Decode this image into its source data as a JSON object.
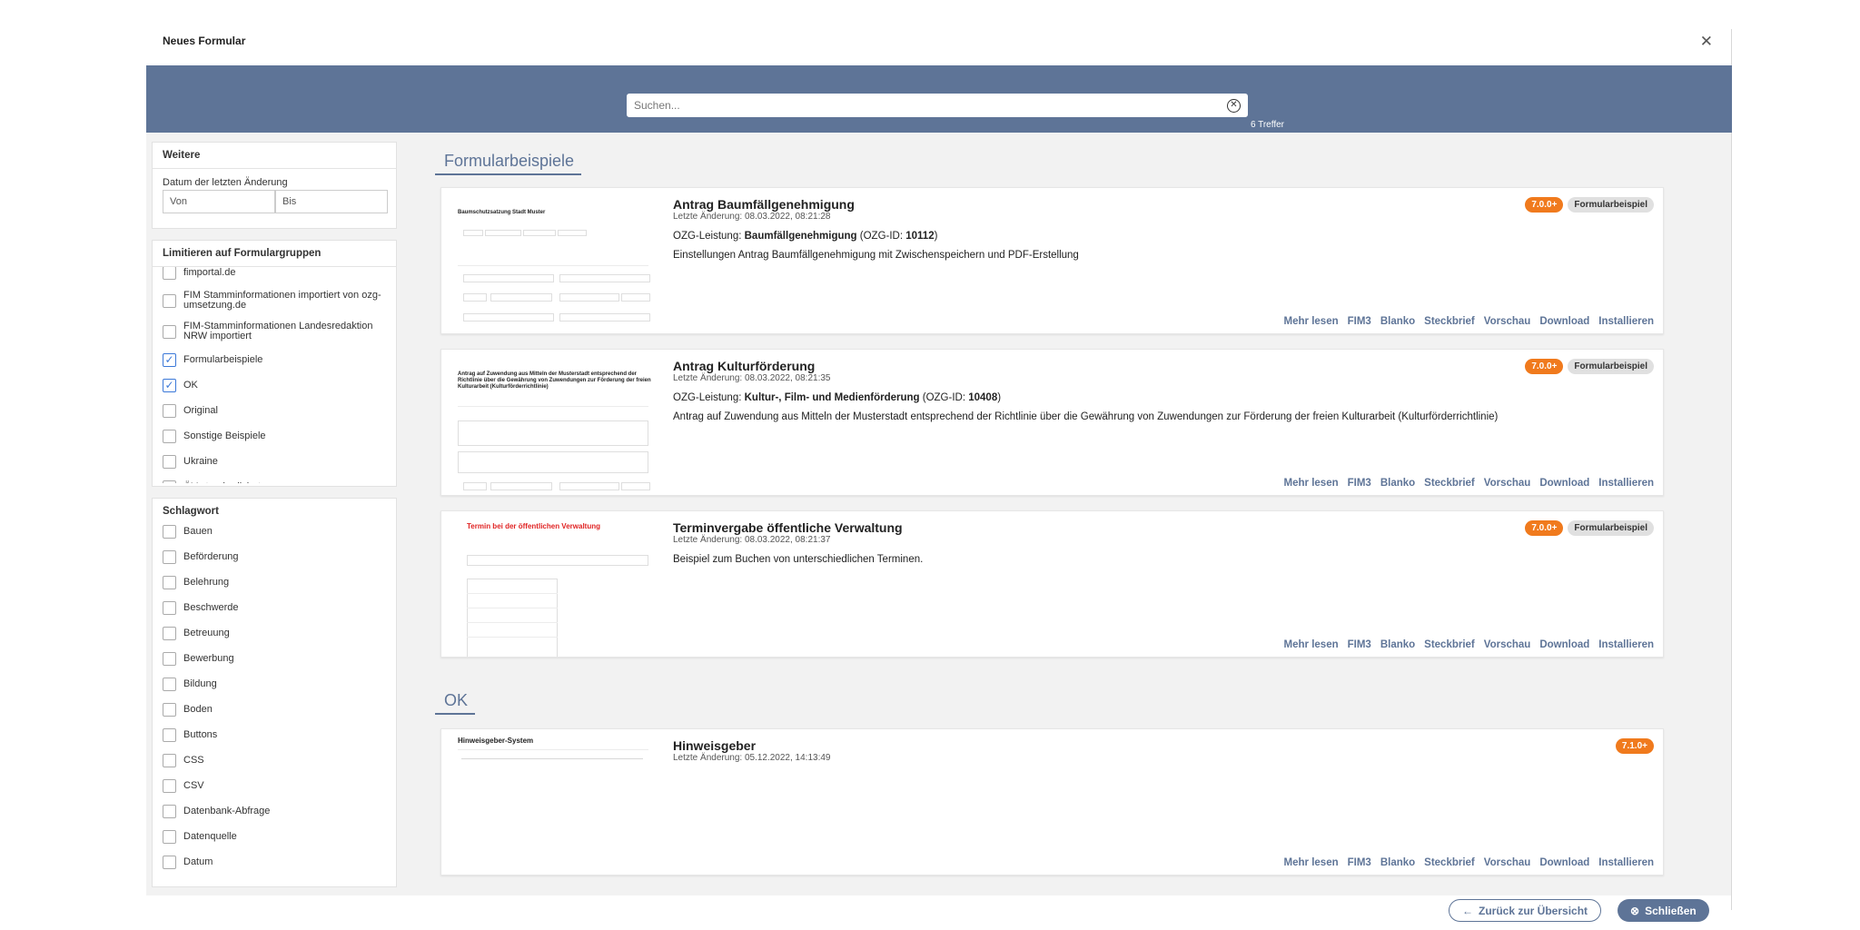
{
  "modal": {
    "title": "Neues Formular"
  },
  "search": {
    "placeholder": "Suchen...",
    "hits": "6 Treffer"
  },
  "sidebar": {
    "weitere": {
      "title": "Weitere",
      "date_label": "Datum der letzten Änderung",
      "from_placeholder": "Von",
      "to_placeholder": "Bis"
    },
    "gruppen": {
      "title": "Limitieren auf Formulargruppen",
      "items": [
        {
          "label": "fimportal.de",
          "checked": false
        },
        {
          "label": "FIM Stamminformationen importiert von ozg-umsetzung.de",
          "checked": false
        },
        {
          "label": "FIM-Stamminformationen Landesredaktion NRW importiert",
          "checked": false
        },
        {
          "label": "Formularbeispiele",
          "checked": true
        },
        {
          "label": "OK",
          "checked": true
        },
        {
          "label": "Original",
          "checked": false
        },
        {
          "label": "Sonstige Beispiele",
          "checked": false
        },
        {
          "label": "Ukraine",
          "checked": false
        },
        {
          "label": "ÖV standardisiert",
          "checked": false
        }
      ]
    },
    "schlagwort": {
      "title": "Schlagwort",
      "items": [
        "Bauen",
        "Beförderung",
        "Belehrung",
        "Beschwerde",
        "Betreuung",
        "Bewerbung",
        "Bildung",
        "Boden",
        "Buttons",
        "CSS",
        "CSV",
        "Datenbank-Abfrage",
        "Datenquelle",
        "Datum"
      ]
    }
  },
  "sections": [
    {
      "heading": "Formularbeispiele",
      "cards": [
        {
          "title": "Antrag Baumfällgenehmigung",
          "date": "Letzte Änderung: 08.03.2022, 08:21:28",
          "ozg_prefix": "OZG-Leistung: ",
          "ozg_name": "Baumfällgenehmigung",
          "ozg_mid": " (OZG-ID: ",
          "ozg_id": "10112",
          "ozg_suffix": ")",
          "description": "Einstellungen Antrag Baumfällgenehmigung mit Zwischenspeichern und PDF-Erstellung",
          "version": "7.0.0+",
          "type": "Formularbeispiel",
          "thumb_title": "Baumschutzsatzung Stadt Muster"
        },
        {
          "title": "Antrag Kulturförderung",
          "date": "Letzte Änderung: 08.03.2022, 08:21:35",
          "ozg_prefix": "OZG-Leistung: ",
          "ozg_name": "Kultur-, Film- und Medienförderung",
          "ozg_mid": " (OZG-ID: ",
          "ozg_id": "10408",
          "ozg_suffix": ")",
          "description": "Antrag auf Zuwendung aus Mitteln der Musterstadt entsprechend der Richtlinie über die Gewährung von Zuwendungen zur Förderung der freien Kulturarbeit (Kulturförderrichtlinie)",
          "version": "7.0.0+",
          "type": "Formularbeispiel",
          "thumb_title": "Antrag auf Zuwendung aus Mitteln der Musterstadt entsprechend der Richtlinie über die Gewährung von Zuwendungen zur Förderung der freien Kulturarbeit (Kulturförderrichtlinie)"
        },
        {
          "title": "Terminvergabe öffentliche Verwaltung",
          "date": "Letzte Änderung: 08.03.2022, 08:21:37",
          "description": "Beispiel zum Buchen von unterschiedlichen Terminen.",
          "version": "7.0.0+",
          "type": "Formularbeispiel",
          "thumb_title": "Termin bei der öffentlichen Verwaltung"
        }
      ]
    },
    {
      "heading": "OK",
      "cards": [
        {
          "title": "Hinweisgeber",
          "date": "Letzte Änderung: 05.12.2022, 14:13:49",
          "version": "7.1.0+",
          "thumb_title": "Hinweisgeber-System"
        }
      ]
    }
  ],
  "actions": [
    "Mehr lesen",
    "FIM3",
    "Blanko",
    "Steckbrief",
    "Vorschau",
    "Download",
    "Installieren"
  ],
  "footer": {
    "back_label": "Zurück zur Übersicht",
    "close_label": "Schließen"
  },
  "colors": {
    "accent": "#5e7497",
    "version_badge": "#f07a1d",
    "checkbox": "#3b78d8"
  }
}
